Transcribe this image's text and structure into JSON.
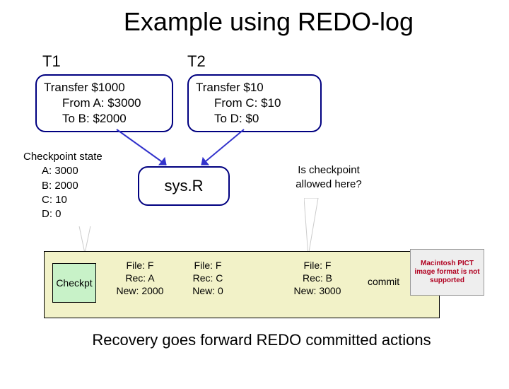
{
  "title": "Example using REDO-log",
  "labels": {
    "t1": "T1",
    "t2": "T2"
  },
  "t1_box": {
    "line1": "Transfer $1000",
    "line2": "From A: $3000",
    "line3": "To B: $2000"
  },
  "t2_box": {
    "line1": "Transfer $10",
    "line2": "From C: $10",
    "line3": "To D: $0"
  },
  "sysr": "sys.R",
  "checkpoint_state": {
    "header": "Checkpoint state",
    "a": "A: 3000",
    "b": "B: 2000",
    "c": "C: 10",
    "d": "D: 0"
  },
  "question": {
    "line1": "Is checkpoint",
    "line2": "allowed here?"
  },
  "log": {
    "checkpt": "Checkpt",
    "entryA": {
      "file": "File: F",
      "rec": "Rec: A",
      "new": "New: 2000"
    },
    "entryC": {
      "file": "File: F",
      "rec": "Rec: C",
      "new": "New: 0"
    },
    "entryB": {
      "file": "File: F",
      "rec": "Rec: B",
      "new": "New: 3000"
    },
    "commit": "commit"
  },
  "placeholder": "Macintosh PICT image format is not supported",
  "footer": "Recovery goes forward REDO committed actions"
}
